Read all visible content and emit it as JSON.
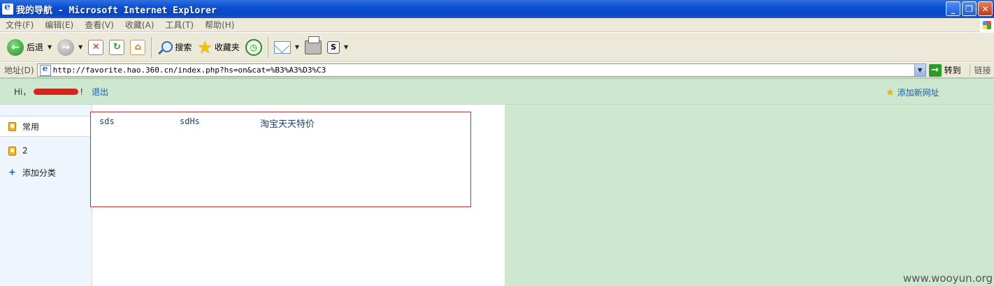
{
  "window": {
    "title": "我的导航 - Microsoft Internet Explorer"
  },
  "menu": {
    "items": [
      "文件(F)",
      "编辑(E)",
      "查看(V)",
      "收藏(A)",
      "工具(T)",
      "帮助(H)"
    ]
  },
  "toolbar": {
    "back_label": "后退",
    "search_label": "搜索",
    "favorites_label": "收藏夹",
    "s_label": "S"
  },
  "address": {
    "label": "地址(D)",
    "url": "http://favorite.hao.360.cn/index.php?hs=on&cat=%B3%A3%D3%C3",
    "go_label": "转到",
    "links_label": "链接"
  },
  "page": {
    "greeting_prefix": "Hi，",
    "greeting_suffix": "!",
    "logout_label": "退出",
    "add_site_label": "添加新网址",
    "categories": [
      {
        "label": "常用",
        "active": true
      },
      {
        "label": "2",
        "active": false
      }
    ],
    "add_category_label": "添加分类",
    "links": [
      "sds",
      "sdHs",
      "淘宝天天特价"
    ]
  },
  "watermark": "www.wooyun.org",
  "colors": {
    "accent_green": "#cde8cf",
    "link_blue": "#1a5ea8",
    "highlight_red": "#c03030"
  }
}
